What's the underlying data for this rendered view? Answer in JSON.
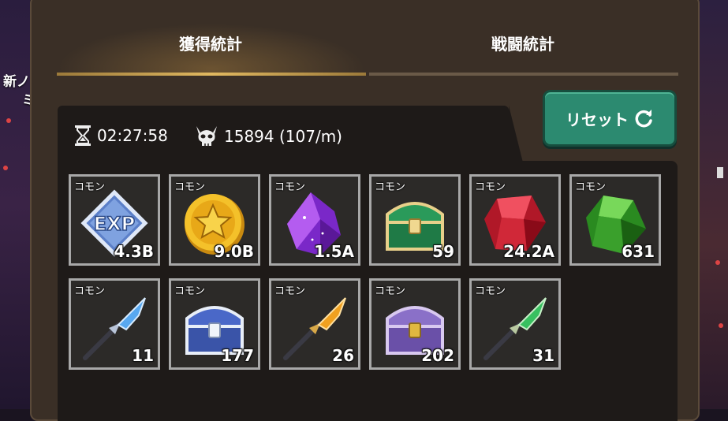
{
  "background": {
    "side_text": [
      "新ノ",
      "ミ"
    ]
  },
  "tabs": [
    {
      "label": "獲得統計",
      "active": true
    },
    {
      "label": "戦闘統計",
      "active": false
    }
  ],
  "reset_button": {
    "label": "リセット",
    "icon": "refresh-icon"
  },
  "stats": {
    "time": "02:27:58",
    "kills": "15894 (107/m)",
    "time_icon": "hourglass-icon",
    "kills_icon": "demon-skull-icon"
  },
  "items": [
    {
      "rarity": "コモン",
      "icon": "exp-badge-icon",
      "quantity": "4.3B"
    },
    {
      "rarity": "コモン",
      "icon": "gold-coin-icon",
      "quantity": "9.0B"
    },
    {
      "rarity": "コモン",
      "icon": "purple-crystal-icon",
      "quantity": "1.5A"
    },
    {
      "rarity": "コモン",
      "icon": "green-chest-icon",
      "quantity": "59"
    },
    {
      "rarity": "コモン",
      "icon": "red-gem-icon",
      "quantity": "24.2A"
    },
    {
      "rarity": "コモン",
      "icon": "green-gem-icon",
      "quantity": "631"
    },
    {
      "rarity": "コモン",
      "icon": "blue-spear-icon",
      "quantity": "11"
    },
    {
      "rarity": "コモン",
      "icon": "blue-chest-icon",
      "quantity": "177"
    },
    {
      "rarity": "コモン",
      "icon": "gold-spear-icon",
      "quantity": "26"
    },
    {
      "rarity": "コモン",
      "icon": "purple-chest-icon",
      "quantity": "202"
    },
    {
      "rarity": "コモン",
      "icon": "green-spear-icon",
      "quantity": "31"
    }
  ],
  "colors": {
    "reset_button": "#2c8a70",
    "active_tab_underline": "#e0b860",
    "item_border": "#a8a8a8"
  }
}
